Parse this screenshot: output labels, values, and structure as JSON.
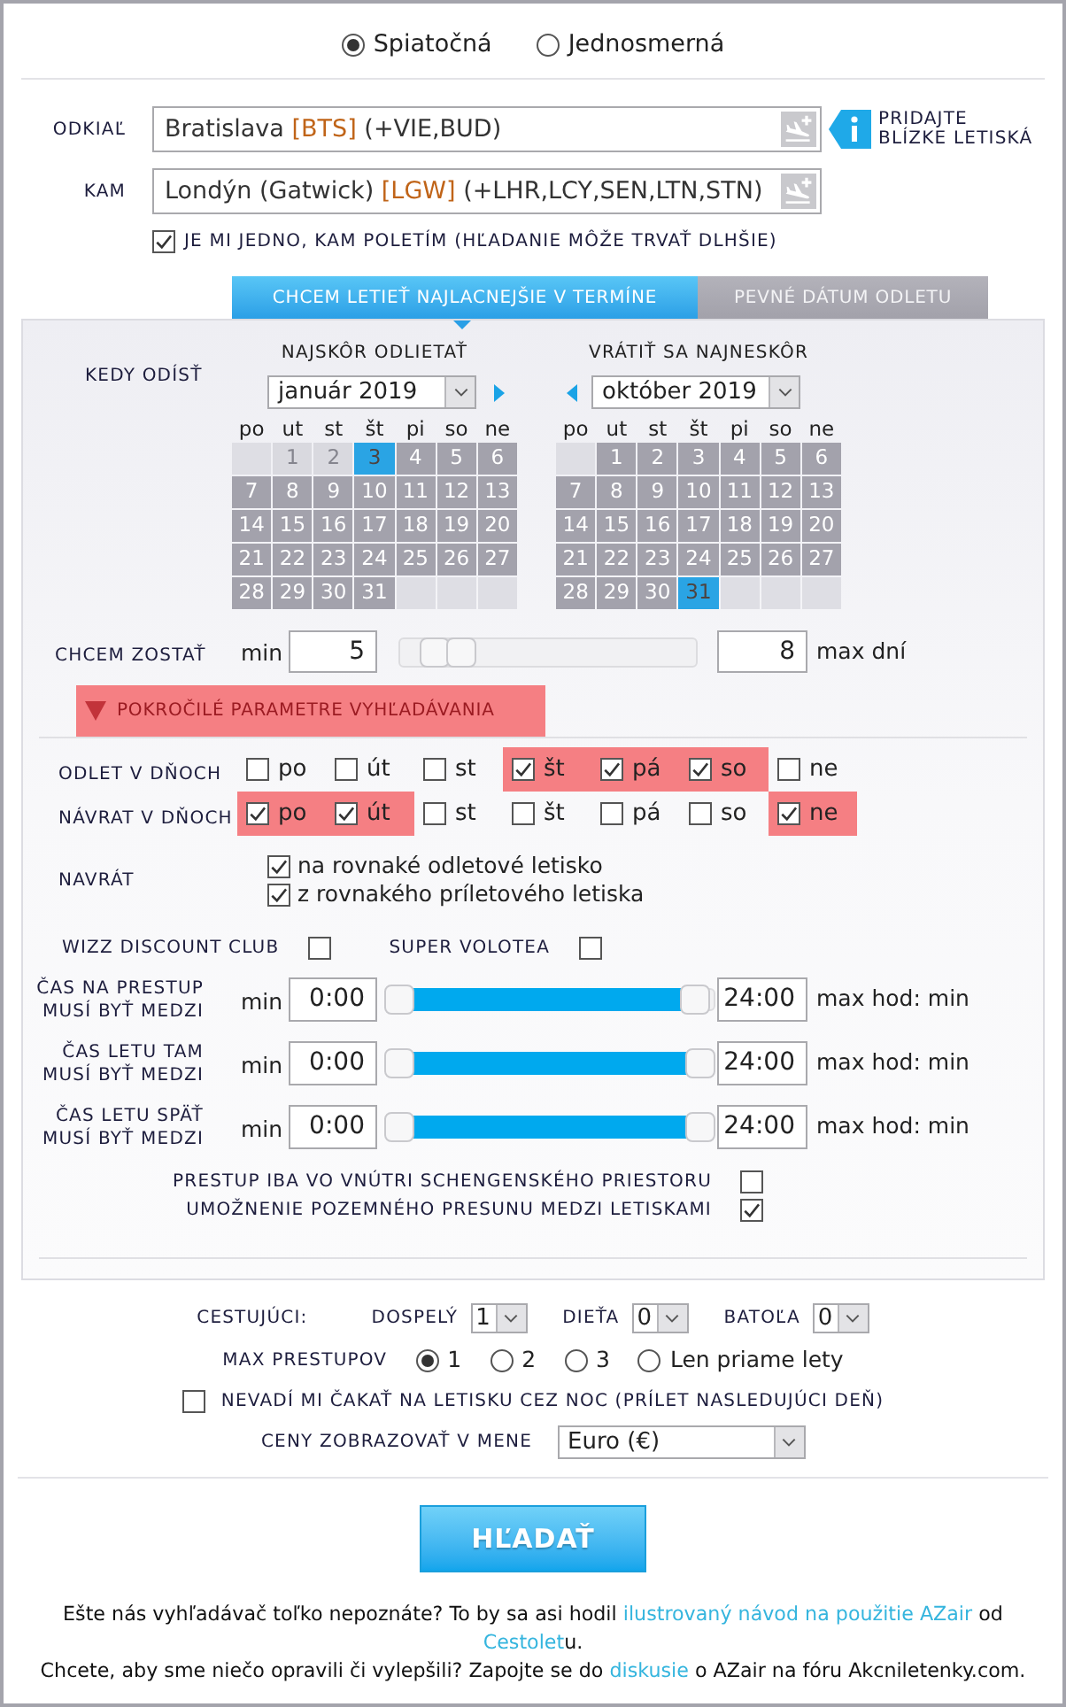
{
  "trip_type": [
    {
      "label": "Spiatočná",
      "selected": true
    },
    {
      "label": "Jednosmerná",
      "selected": false
    }
  ],
  "route": {
    "fields": [
      {
        "label": "ODKIAĽ",
        "city": "Bratislava",
        "code": "[BTS]",
        "extra": "(+VIE,BUD)"
      },
      {
        "label": "KAM",
        "city": "Londýn (Gatwick)",
        "code": "[LGW]",
        "extra": "(+LHR,LCY,SEN,LTN,STN)"
      }
    ],
    "hint_lines": [
      "PRIDAJTE",
      "BLÍZKE LETISKÁ"
    ],
    "anywhere": {
      "label": "JE MI JEDNO, KAM POLETÍM (HĽADANIE MÔŽE TRVAŤ DLHŠIE)",
      "checked": true
    }
  },
  "date_tabs": [
    {
      "label": "CHCEM LETIEŤ NAJLACNEJŠIE V TERMÍNE",
      "selected": true
    },
    {
      "label": "PEVNÉ DÁTUM ODLETU",
      "selected": false
    }
  ],
  "when": {
    "label": "KEDY ODÍSŤ",
    "calendars": [
      {
        "title": "NAJSKÔR ODLIETAŤ",
        "month": "január 2019",
        "prev_arrow": false,
        "next_arrow": true,
        "weekdays": [
          "po",
          "ut",
          "st",
          "št",
          "pi",
          "so",
          "ne"
        ],
        "weeks": [
          [
            {
              "kind": "blank"
            },
            {
              "kind": "day",
              "day": "1",
              "selected": false,
              "disabled": true
            },
            {
              "kind": "day",
              "day": "2",
              "selected": false,
              "disabled": true
            },
            {
              "kind": "day",
              "day": "3",
              "selected": true,
              "disabled": false
            },
            {
              "kind": "day",
              "day": "4",
              "selected": false,
              "disabled": false
            },
            {
              "kind": "day",
              "day": "5",
              "selected": false,
              "disabled": false
            },
            {
              "kind": "day",
              "day": "6",
              "selected": false,
              "disabled": false
            }
          ],
          [
            {
              "kind": "day",
              "day": "7",
              "selected": false,
              "disabled": false
            },
            {
              "kind": "day",
              "day": "8",
              "selected": false,
              "disabled": false
            },
            {
              "kind": "day",
              "day": "9",
              "selected": false,
              "disabled": false
            },
            {
              "kind": "day",
              "day": "10",
              "selected": false,
              "disabled": false
            },
            {
              "kind": "day",
              "day": "11",
              "selected": false,
              "disabled": false
            },
            {
              "kind": "day",
              "day": "12",
              "selected": false,
              "disabled": false
            },
            {
              "kind": "day",
              "day": "13",
              "selected": false,
              "disabled": false
            }
          ],
          [
            {
              "kind": "day",
              "day": "14",
              "selected": false,
              "disabled": false
            },
            {
              "kind": "day",
              "day": "15",
              "selected": false,
              "disabled": false
            },
            {
              "kind": "day",
              "day": "16",
              "selected": false,
              "disabled": false
            },
            {
              "kind": "day",
              "day": "17",
              "selected": false,
              "disabled": false
            },
            {
              "kind": "day",
              "day": "18",
              "selected": false,
              "disabled": false
            },
            {
              "kind": "day",
              "day": "19",
              "selected": false,
              "disabled": false
            },
            {
              "kind": "day",
              "day": "20",
              "selected": false,
              "disabled": false
            }
          ],
          [
            {
              "kind": "day",
              "day": "21",
              "selected": false,
              "disabled": false
            },
            {
              "kind": "day",
              "day": "22",
              "selected": false,
              "disabled": false
            },
            {
              "kind": "day",
              "day": "23",
              "selected": false,
              "disabled": false
            },
            {
              "kind": "day",
              "day": "24",
              "selected": false,
              "disabled": false
            },
            {
              "kind": "day",
              "day": "25",
              "selected": false,
              "disabled": false
            },
            {
              "kind": "day",
              "day": "26",
              "selected": false,
              "disabled": false
            },
            {
              "kind": "day",
              "day": "27",
              "selected": false,
              "disabled": false
            }
          ],
          [
            {
              "kind": "day",
              "day": "28",
              "selected": false,
              "disabled": false
            },
            {
              "kind": "day",
              "day": "29",
              "selected": false,
              "disabled": false
            },
            {
              "kind": "day",
              "day": "30",
              "selected": false,
              "disabled": false
            },
            {
              "kind": "day",
              "day": "31",
              "selected": false,
              "disabled": false
            },
            {
              "kind": "blank"
            },
            {
              "kind": "blank"
            },
            {
              "kind": "blank"
            }
          ]
        ]
      },
      {
        "title": "VRÁTIŤ SA NAJNESKÔR",
        "month": "október 2019",
        "prev_arrow": true,
        "next_arrow": false,
        "weekdays": [
          "po",
          "ut",
          "st",
          "št",
          "pi",
          "so",
          "ne"
        ],
        "weeks": [
          [
            {
              "kind": "blank"
            },
            {
              "kind": "day",
              "day": "1",
              "selected": false,
              "disabled": false
            },
            {
              "kind": "day",
              "day": "2",
              "selected": false,
              "disabled": false
            },
            {
              "kind": "day",
              "day": "3",
              "selected": false,
              "disabled": false
            },
            {
              "kind": "day",
              "day": "4",
              "selected": false,
              "disabled": false
            },
            {
              "kind": "day",
              "day": "5",
              "selected": false,
              "disabled": false
            },
            {
              "kind": "day",
              "day": "6",
              "selected": false,
              "disabled": false
            }
          ],
          [
            {
              "kind": "day",
              "day": "7",
              "selected": false,
              "disabled": false
            },
            {
              "kind": "day",
              "day": "8",
              "selected": false,
              "disabled": false
            },
            {
              "kind": "day",
              "day": "9",
              "selected": false,
              "disabled": false
            },
            {
              "kind": "day",
              "day": "10",
              "selected": false,
              "disabled": false
            },
            {
              "kind": "day",
              "day": "11",
              "selected": false,
              "disabled": false
            },
            {
              "kind": "day",
              "day": "12",
              "selected": false,
              "disabled": false
            },
            {
              "kind": "day",
              "day": "13",
              "selected": false,
              "disabled": false
            }
          ],
          [
            {
              "kind": "day",
              "day": "14",
              "selected": false,
              "disabled": false
            },
            {
              "kind": "day",
              "day": "15",
              "selected": false,
              "disabled": false
            },
            {
              "kind": "day",
              "day": "16",
              "selected": false,
              "disabled": false
            },
            {
              "kind": "day",
              "day": "17",
              "selected": false,
              "disabled": false
            },
            {
              "kind": "day",
              "day": "18",
              "selected": false,
              "disabled": false
            },
            {
              "kind": "day",
              "day": "19",
              "selected": false,
              "disabled": false
            },
            {
              "kind": "day",
              "day": "20",
              "selected": false,
              "disabled": false
            }
          ],
          [
            {
              "kind": "day",
              "day": "21",
              "selected": false,
              "disabled": false
            },
            {
              "kind": "day",
              "day": "22",
              "selected": false,
              "disabled": false
            },
            {
              "kind": "day",
              "day": "23",
              "selected": false,
              "disabled": false
            },
            {
              "kind": "day",
              "day": "24",
              "selected": false,
              "disabled": false
            },
            {
              "kind": "day",
              "day": "25",
              "selected": false,
              "disabled": false
            },
            {
              "kind": "day",
              "day": "26",
              "selected": false,
              "disabled": false
            },
            {
              "kind": "day",
              "day": "27",
              "selected": false,
              "disabled": false
            }
          ],
          [
            {
              "kind": "day",
              "day": "28",
              "selected": false,
              "disabled": false
            },
            {
              "kind": "day",
              "day": "29",
              "selected": false,
              "disabled": false
            },
            {
              "kind": "day",
              "day": "30",
              "selected": false,
              "disabled": false
            },
            {
              "kind": "day",
              "day": "31",
              "selected": true,
              "disabled": false
            },
            {
              "kind": "blank"
            },
            {
              "kind": "blank"
            },
            {
              "kind": "blank"
            }
          ]
        ]
      }
    ]
  },
  "stay": {
    "label": "CHCEM ZOSTAŤ",
    "min_label": "min",
    "min": "5",
    "max": "8",
    "max_label": "max dní",
    "thumbs": [
      {
        "level": 0.08
      },
      {
        "level": 0.18
      }
    ]
  },
  "advanced": {
    "label": "POKROČILÉ PARAMETRE VYHĽADÁVANIA",
    "expanded": true
  },
  "day_filters": [
    {
      "label": "ODLET V DŇOCH",
      "days": [
        {
          "label": "po",
          "checked": false
        },
        {
          "label": "út",
          "checked": false
        },
        {
          "label": "st",
          "checked": false
        },
        {
          "label": "št",
          "checked": true
        },
        {
          "label": "pá",
          "checked": true
        },
        {
          "label": "so",
          "checked": true
        },
        {
          "label": "ne",
          "checked": false
        }
      ]
    },
    {
      "label": "NÁVRAT V DŇOCH",
      "days": [
        {
          "label": "po",
          "checked": true
        },
        {
          "label": "út",
          "checked": true
        },
        {
          "label": "st",
          "checked": false
        },
        {
          "label": "št",
          "checked": false
        },
        {
          "label": "pá",
          "checked": false
        },
        {
          "label": "so",
          "checked": false
        },
        {
          "label": "ne",
          "checked": true
        }
      ]
    }
  ],
  "return": {
    "label": "NAVRÁT",
    "options": [
      {
        "label": "na rovnaké odletové letisko",
        "checked": true
      },
      {
        "label": "z rovnakého príletového letiska",
        "checked": true
      }
    ]
  },
  "clubs": [
    {
      "label": "WIZZ DISCOUNT CLUB",
      "checked": false
    },
    {
      "label": "SUPER VOLOTEA",
      "checked": false
    }
  ],
  "time_ranges": [
    {
      "label_lines": [
        "ČAS NA PRESTUP",
        "MUSÍ BYŤ MEDZI"
      ],
      "min_label": "min",
      "min": "0:00",
      "max": "24:00",
      "max_label": "max hod: min",
      "thumbs": [
        {
          "level": 0
        },
        {
          "level": 0.98
        }
      ]
    },
    {
      "label_lines": [
        "ČAS LETU TAM",
        "MUSÍ BYŤ MEDZI"
      ],
      "min_label": "min",
      "min": "0:00",
      "max": "24:00",
      "max_label": "max hod: min",
      "thumbs": [
        {
          "level": 0
        },
        {
          "level": 1
        }
      ]
    },
    {
      "label_lines": [
        "ČAS LETU SPÄŤ",
        "MUSÍ BYŤ MEDZI"
      ],
      "min_label": "min",
      "min": "0:00",
      "max": "24:00",
      "max_label": "max hod: min",
      "thumbs": [
        {
          "level": 0
        },
        {
          "level": 1
        }
      ]
    }
  ],
  "transfer_options": [
    {
      "label": "PRESTUP IBA VO VNÚTRI SCHENGENSKÉHO PRIESTORU",
      "checked": false
    },
    {
      "label": "UMOŽNENIE POZEMNÉHO PRESUNU MEDZI LETISKAMI",
      "checked": true
    }
  ],
  "passengers": {
    "label": "CESTUJÚCI:",
    "groups": [
      {
        "label": "DOSPELÝ",
        "value": "1"
      },
      {
        "label": "DIEŤA",
        "value": "0"
      },
      {
        "label": "BATOĽA",
        "value": "0"
      }
    ]
  },
  "max_transfers": {
    "label": "MAX PRESTUPOV",
    "options": [
      {
        "label": "1",
        "selected": true
      },
      {
        "label": "2",
        "selected": false
      },
      {
        "label": "3",
        "selected": false
      },
      {
        "label": "Len priame lety",
        "selected": false
      }
    ]
  },
  "overnight": {
    "label": "NEVADÍ MI ČAKAŤ NA LETISKU CEZ NOC (PRÍLET NASLEDUJÚCI DEŇ)",
    "checked": false
  },
  "currency": {
    "label": "CENY ZOBRAZOVAŤ V MENE",
    "value": "Euro (€)"
  },
  "search_button": "HĽADAŤ",
  "footer": [
    [
      {
        "kind": "text",
        "text": "Ešte nás vyhľadávač toľko nepoznáte? To by sa asi hodil "
      },
      {
        "kind": "link",
        "text": "ilustrovaný návod na použitie AZair"
      },
      {
        "kind": "text",
        "text": " od "
      },
      {
        "kind": "link",
        "text": "Cestolet"
      },
      {
        "kind": "text",
        "text": "u."
      }
    ],
    [
      {
        "kind": "text",
        "text": "Chcete, aby sme niečo opravili či vylepšili? Zapojte se do "
      },
      {
        "kind": "link",
        "text": "diskusie"
      },
      {
        "kind": "text",
        "text": " o AZair na fóru Akcniletenky.com."
      }
    ]
  ]
}
